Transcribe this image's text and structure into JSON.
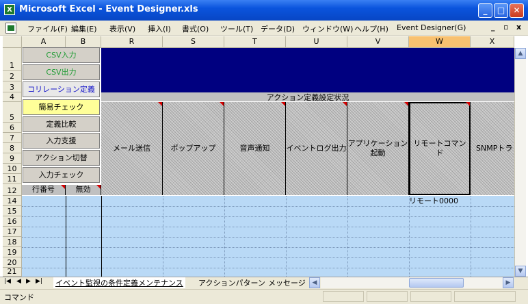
{
  "window": {
    "title": "Microsoft Excel - Event Designer.xls",
    "app_icon": "X",
    "min": "_",
    "max": "□",
    "close": "✕"
  },
  "menu": [
    "ファイル(F)",
    "編集(E)",
    "表示(V)",
    "挿入(I)",
    "書式(O)",
    "ツール(T)",
    "データ(D)",
    "ウィンドウ(W)",
    "ヘルプ(H)",
    "Event Designer(G)"
  ],
  "doc_controls": {
    "min": "_",
    "restore": "▫",
    "close": "x"
  },
  "columns": [
    "A",
    "B",
    "R",
    "S",
    "T",
    "U",
    "V",
    "W",
    "X"
  ],
  "rows": [
    "1",
    "2",
    "3",
    "4",
    "5",
    "6",
    "7",
    "8",
    "9",
    "10",
    "11",
    "12",
    "14",
    "15",
    "16",
    "17",
    "18",
    "19",
    "20",
    "21"
  ],
  "left_buttons": [
    "CSV入力",
    "CSV出力",
    "コリレーション定義",
    "簡易チェック",
    "定義比較",
    "入力支援",
    "アクション切替",
    "入力チェック"
  ],
  "row_labels": {
    "line_no": "行番号",
    "disabled": "無効"
  },
  "section_title": "アクション定義設定状況",
  "headers": [
    "メール送信",
    "ポップアップ",
    "音声通知",
    "イベントログ出力",
    "アプリケーション\n起動",
    "リモートコマンド",
    "SNMPトラ"
  ],
  "cell_w14": "リモート0000",
  "sheet_tabs": [
    "イベント監視の条件定義メンテナンス",
    "アクションパターン",
    "メッセージ"
  ],
  "status": "コマンド",
  "colors": {
    "navy": "#000080",
    "header_hatch": "#c4c4c4",
    "data_blue": "#b9d9f6",
    "selected_col": "#f8c170"
  }
}
